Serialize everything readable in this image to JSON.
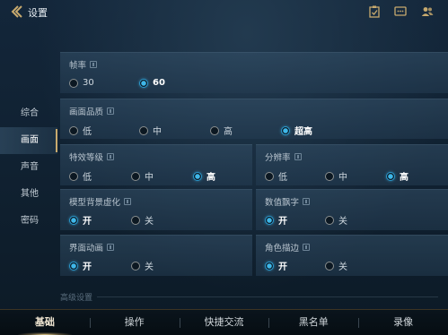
{
  "header": {
    "title": "设置"
  },
  "sidebar": {
    "items": [
      {
        "label": "综合"
      },
      {
        "label": "画面"
      },
      {
        "label": "声音"
      },
      {
        "label": "其他"
      },
      {
        "label": "密码"
      }
    ],
    "active_index": 1
  },
  "settings": {
    "frame_rate": {
      "title": "帧率",
      "options": [
        "30",
        "60"
      ],
      "selected": "60"
    },
    "quality": {
      "title": "画面品质",
      "options": [
        "低",
        "中",
        "高",
        "超高"
      ],
      "selected": "超高"
    },
    "effects": {
      "title": "特效等级",
      "options": [
        "低",
        "中",
        "高"
      ],
      "selected": "高"
    },
    "resolution": {
      "title": "分辨率",
      "options": [
        "低",
        "中",
        "高"
      ],
      "selected": "高"
    },
    "model_blur": {
      "title": "模型背景虚化",
      "options": [
        "开",
        "关"
      ],
      "selected": "开"
    },
    "damage_text": {
      "title": "数值飘字",
      "options": [
        "开",
        "关"
      ],
      "selected": "开"
    },
    "ui_animation": {
      "title": "界面动画",
      "options": [
        "开",
        "关"
      ],
      "selected": "开"
    },
    "outline": {
      "title": "角色描边",
      "options": [
        "开",
        "关"
      ],
      "selected": "开"
    },
    "advanced_label": "高级设置"
  },
  "bottom_tabs": {
    "items": [
      {
        "label": "基础"
      },
      {
        "label": "操作"
      },
      {
        "label": "快捷交流"
      },
      {
        "label": "黑名单"
      },
      {
        "label": "录像"
      }
    ],
    "active_index": 0
  },
  "colors": {
    "accent": "#2a9bd1",
    "gold": "#c8aa6e"
  }
}
